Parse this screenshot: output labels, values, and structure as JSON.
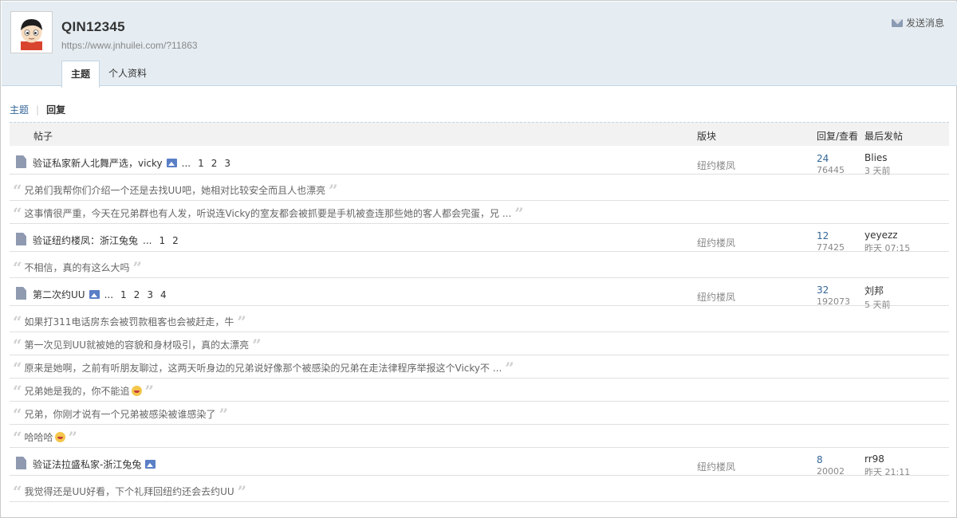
{
  "profile": {
    "username": "QIN12345",
    "url": "https://www.jnhuilei.com/?11863",
    "send_message_label": "发送消息"
  },
  "tabs": [
    {
      "label": "主题",
      "active": true
    },
    {
      "label": "个人资料",
      "active": false
    }
  ],
  "subnav": {
    "topics_label": "主题",
    "separator": "|",
    "replies_label": "回复"
  },
  "table_header": {
    "post": "帖子",
    "forum": "版块",
    "reply_view": "回复/查看",
    "last_post": "最后发帖"
  },
  "threads": [
    {
      "title": "验证私家新人北舞严选，vicky",
      "has_image": true,
      "ellipsis": "...",
      "pages": [
        "1",
        "2",
        "3"
      ],
      "forum": "纽约楼凤",
      "replies": "24",
      "views": "76445",
      "last_user": "Blies",
      "last_time": "3 天前",
      "reply_quotes": [
        "兄弟们我帮你们介绍一个还是去找UU吧，她相对比较安全而且人也漂亮",
        "这事情很严重，今天在兄弟群也有人发，听说连Vicky的室友都会被抓要是手机被查连那些她的客人都会完蛋，兄 ..."
      ]
    },
    {
      "title": "验证纽约楼凤：浙江兔兔",
      "has_image": false,
      "ellipsis": "...",
      "pages": [
        "1",
        "2"
      ],
      "forum": "纽约楼凤",
      "replies": "12",
      "views": "77425",
      "last_user": "yeyezz",
      "last_time": "昨天 07:15",
      "reply_quotes": [
        "不相信，真的有这么大吗"
      ]
    },
    {
      "title": "第二次约UU",
      "has_image": true,
      "ellipsis": "...",
      "pages": [
        "1",
        "2",
        "3",
        "4"
      ],
      "forum": "纽约楼凤",
      "replies": "32",
      "views": "192073",
      "last_user": "刘邦",
      "last_time": "5 天前",
      "reply_quotes": [
        "如果打311电话房东会被罚款租客也会被赶走，牛",
        "第一次见到UU就被她的容貌和身材吸引，真的太漂亮",
        "原来是她啊，之前有听朋友聊过，这两天听身边的兄弟说好像那个被感染的兄弟在走法律程序举报这个Vicky不 ...",
        "兄弟她是我的，你不能追",
        "兄弟，你刚才说有一个兄弟被感染被谁感染了",
        "哈哈哈"
      ]
    },
    {
      "title": "验证法拉盛私家-浙江兔兔",
      "has_image": true,
      "ellipsis": "",
      "pages": [],
      "forum": "纽约楼凤",
      "replies": "8",
      "views": "20002",
      "last_user": "rr98",
      "last_time": "昨天 21:11",
      "reply_quotes": [
        "我觉得还是UU好看，下个礼拜回纽约还会去约UU"
      ]
    }
  ],
  "icons": {
    "mail": "mail-icon",
    "thread": "document-icon",
    "image": "image-attachment-icon",
    "quote_open": "“",
    "quote_close": "”",
    "emoji": "laughing-emoji-icon"
  },
  "colors": {
    "header_bg": "#e5edf2",
    "link": "#336699",
    "muted": "#888888"
  }
}
